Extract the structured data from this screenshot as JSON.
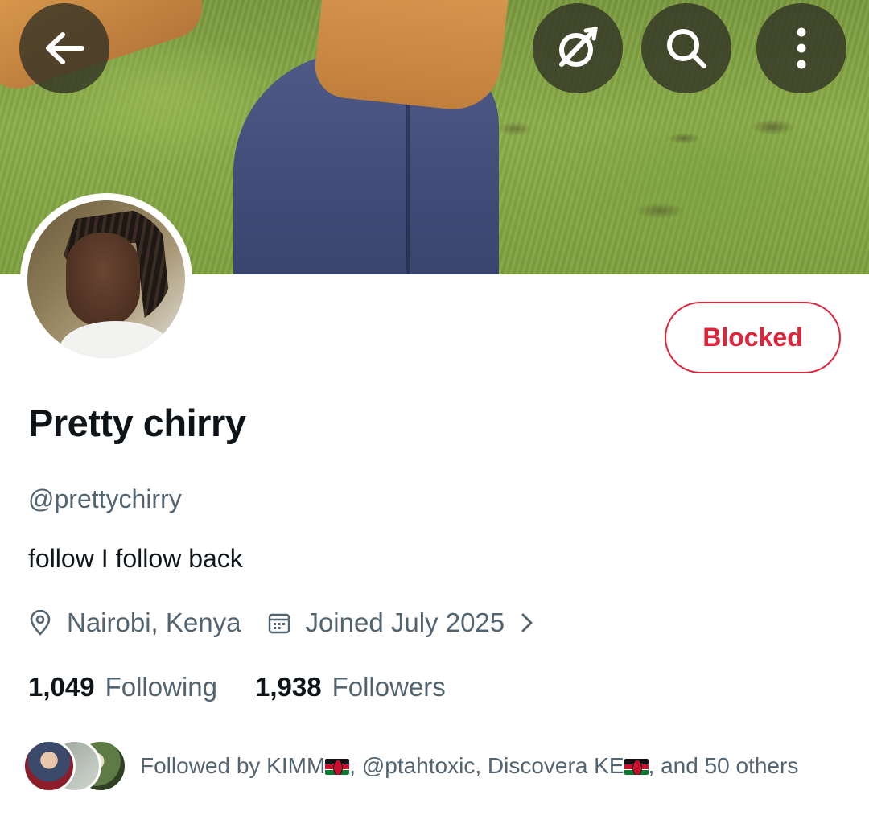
{
  "header": {
    "back_icon": "arrow-left-icon",
    "grok_icon": "grok-icon",
    "search_icon": "search-icon",
    "more_icon": "more-vertical-icon"
  },
  "profile": {
    "display_name": "Pretty chirry",
    "handle": "@prettychirry",
    "bio": "follow I follow back",
    "location": "Nairobi, Kenya",
    "joined": "Joined July 2025",
    "blocked_label": "Blocked"
  },
  "stats": {
    "following_count": "1,049",
    "following_label": "Following",
    "followers_count": "1,938",
    "followers_label": "Followers"
  },
  "followed_by": {
    "prefix": "Followed by KIMM",
    "middle": ", @ptahtoxic, Discovera KE",
    "suffix": ", and 50 others"
  },
  "colors": {
    "accent_red": "#e0253a",
    "secondary_text": "#536471",
    "primary_text": "#0f1419"
  }
}
